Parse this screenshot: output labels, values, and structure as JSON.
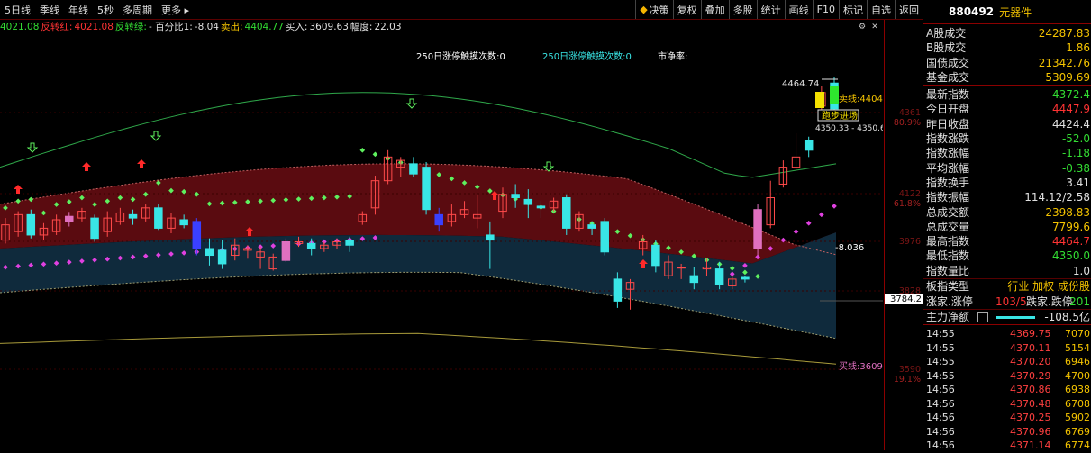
{
  "toolbar": {
    "left": [
      "5日线",
      "季线",
      "年线",
      "5秒",
      "多周期",
      "更多 ▸"
    ],
    "right": [
      "决策",
      "复权",
      "叠加",
      "多股",
      "统计",
      "画线",
      "F10",
      "标记",
      "自选",
      "返回"
    ]
  },
  "indicator_bar": [
    {
      "text": "4021.08",
      "color": "#33dd33"
    },
    {
      "text": "反转红:",
      "color": "#ff3333"
    },
    {
      "text": "4021.08",
      "color": "#ff3333"
    },
    {
      "text": "反转绿:",
      "color": "#33dd33"
    },
    {
      "text": "- 百分比1:",
      "color": "#e0e0e0"
    },
    {
      "text": "-8.04",
      "color": "#e0e0e0"
    },
    {
      "text": "卖出:",
      "color": "#f5c400"
    },
    {
      "text": "4404.77",
      "color": "#33dd33"
    },
    {
      "text": "买入:",
      "color": "#e0e0e0"
    },
    {
      "text": "3609.63",
      "color": "#e0e0e0"
    },
    {
      "text": "幅度:",
      "color": "#e0e0e0"
    },
    {
      "text": "22.03",
      "color": "#e0e0e0"
    }
  ],
  "chart_labels": {
    "touch1": "250日涨停触摸次数:0",
    "touch2": "250日涨停触摸次数:0",
    "pb": "市净率:",
    "high_mark": "4464.74",
    "sell_line": "卖线:4404",
    "run_enter": "跑步进场",
    "range_text": "4350.33 - 4350.6",
    "value_mark": "-8.036",
    "buy_line": "买线:3609"
  },
  "y_axis": [
    {
      "value": "4361",
      "pct": "80.9%"
    },
    {
      "value": "4122",
      "pct": "61.8%"
    },
    {
      "value": "3976",
      "pct": ""
    },
    {
      "value": "3828",
      "pct": ""
    },
    {
      "value": "3590",
      "pct": "19.1%"
    }
  ],
  "y_highlight": "3784.2",
  "panel": {
    "code": "880492",
    "name": "元器件",
    "rows1": [
      {
        "k": "A股成交",
        "v": "24287.83",
        "c": "#f5c400"
      },
      {
        "k": "B股成交",
        "v": "1.86",
        "c": "#f5c400"
      },
      {
        "k": "国债成交",
        "v": "21342.76",
        "c": "#f5c400"
      },
      {
        "k": "基金成交",
        "v": "5309.69",
        "c": "#f5c400"
      }
    ],
    "rows2": [
      {
        "k": "最新指数",
        "v": "4372.4",
        "c": "#33dd33"
      },
      {
        "k": "今日开盘",
        "v": "4447.9",
        "c": "#ff3333"
      },
      {
        "k": "昨日收盘",
        "v": "4424.4",
        "c": "#e0e0e0"
      },
      {
        "k": "指数涨跌",
        "v": "-52.0",
        "c": "#33dd33"
      },
      {
        "k": "指数涨幅",
        "v": "-1.18",
        "c": "#33dd33"
      },
      {
        "k": "平均涨幅",
        "v": "-0.38",
        "c": "#33dd33"
      },
      {
        "k": "指数换手",
        "v": "3.41",
        "c": "#e0e0e0"
      },
      {
        "k": "指数振幅",
        "v": "114.12/2.58",
        "c": "#e0e0e0"
      },
      {
        "k": "总成交额",
        "v": "2398.83",
        "c": "#f5c400"
      },
      {
        "k": "总成交量",
        "v": "7799.6",
        "c": "#f5c400"
      },
      {
        "k": "最高指数",
        "v": "4464.7",
        "c": "#ff3333"
      },
      {
        "k": "最低指数",
        "v": "4350.0",
        "c": "#33dd33"
      },
      {
        "k": "指数量比",
        "v": "1.0",
        "c": "#e0e0e0"
      }
    ],
    "board_type": {
      "k": "板指类型",
      "v": "行业 加权 成份股"
    },
    "updown": {
      "k1": "涨家.涨停",
      "v1": "103/5",
      "k2": "跌家.跌停",
      "v2": "201"
    },
    "net": {
      "k": "主力净额",
      "v": "-108.5亿"
    },
    "ticks": [
      {
        "t": "14:55",
        "p": "4369.75",
        "q": "7070"
      },
      {
        "t": "14:55",
        "p": "4370.11",
        "q": "5154"
      },
      {
        "t": "14:55",
        "p": "4370.20",
        "q": "6946"
      },
      {
        "t": "14:55",
        "p": "4370.29",
        "q": "4700"
      },
      {
        "t": "14:56",
        "p": "4370.86",
        "q": "6938"
      },
      {
        "t": "14:56",
        "p": "4370.48",
        "q": "6708"
      },
      {
        "t": "14:56",
        "p": "4370.25",
        "q": "5902"
      },
      {
        "t": "14:56",
        "p": "4370.96",
        "q": "6769"
      },
      {
        "t": "14:56",
        "p": "4371.14",
        "q": "6774"
      }
    ]
  },
  "chart_data": {
    "type": "candlestick",
    "candles": [
      {
        "o": 3985,
        "c": 4030,
        "h": 4050,
        "l": 3975
      },
      {
        "o": 4010,
        "c": 4060,
        "h": 4070,
        "l": 3995
      },
      {
        "o": 4060,
        "c": 4000,
        "h": 4075,
        "l": 3990
      },
      {
        "o": 4000,
        "c": 4020,
        "h": 4035,
        "l": 3985
      },
      {
        "o": 4010,
        "c": 4045,
        "h": 4060,
        "l": 4000
      },
      {
        "o": 4040,
        "c": 4055,
        "h": 4068,
        "l": 4025
      },
      {
        "o": 4050,
        "c": 4070,
        "h": 4080,
        "l": 4040
      },
      {
        "o": 4050,
        "c": 3990,
        "h": 4060,
        "l": 3980
      },
      {
        "o": 4010,
        "c": 4050,
        "h": 4070,
        "l": 3995
      },
      {
        "o": 4040,
        "c": 4065,
        "h": 4080,
        "l": 4030
      },
      {
        "o": 4060,
        "c": 4050,
        "h": 4075,
        "l": 4030
      },
      {
        "o": 4050,
        "c": 4080,
        "h": 4090,
        "l": 4040
      },
      {
        "o": 4080,
        "c": 4020,
        "h": 4090,
        "l": 4015
      },
      {
        "o": 4020,
        "c": 4050,
        "h": 4065,
        "l": 4005
      },
      {
        "o": 4045,
        "c": 4030,
        "h": 4060,
        "l": 4020
      },
      {
        "o": 4040,
        "c": 3960,
        "h": 4050,
        "l": 3940
      },
      {
        "o": 3960,
        "c": 3940,
        "h": 3990,
        "l": 3910
      },
      {
        "o": 3955,
        "c": 3915,
        "h": 3985,
        "l": 3900
      },
      {
        "o": 3940,
        "c": 3970,
        "h": 3990,
        "l": 3925
      },
      {
        "o": 3955,
        "c": 3960,
        "h": 3970,
        "l": 3930
      },
      {
        "o": 3935,
        "c": 3950,
        "h": 3965,
        "l": 3900
      },
      {
        "o": 3900,
        "c": 3935,
        "h": 3945,
        "l": 3895
      },
      {
        "o": 3925,
        "c": 3980,
        "h": 3990,
        "l": 3920
      },
      {
        "o": 3975,
        "c": 3980,
        "h": 3995,
        "l": 3965
      },
      {
        "o": 3975,
        "c": 3960,
        "h": 3990,
        "l": 3940
      },
      {
        "o": 3960,
        "c": 3970,
        "h": 3980,
        "l": 3950
      },
      {
        "o": 3970,
        "c": 3980,
        "h": 3990,
        "l": 3960
      },
      {
        "o": 3985,
        "c": 3970,
        "h": 3995,
        "l": 3950
      },
      {
        "o": 4040,
        "c": 4060,
        "h": 4070,
        "l": 4030
      },
      {
        "o": 4080,
        "c": 4160,
        "h": 4175,
        "l": 4060
      },
      {
        "o": 4160,
        "c": 4230,
        "h": 4250,
        "l": 4150
      },
      {
        "o": 4200,
        "c": 4220,
        "h": 4230,
        "l": 4170
      },
      {
        "o": 4210,
        "c": 4180,
        "h": 4230,
        "l": 4170
      },
      {
        "o": 4200,
        "c": 4075,
        "h": 4215,
        "l": 4060
      },
      {
        "o": 4060,
        "c": 4030,
        "h": 4080,
        "l": 4010
      },
      {
        "o": 4040,
        "c": 4060,
        "h": 4090,
        "l": 4025
      },
      {
        "o": 4060,
        "c": 4075,
        "h": 4100,
        "l": 4050
      },
      {
        "o": 4050,
        "c": 4060,
        "h": 4120,
        "l": 4020
      },
      {
        "o": 4000,
        "c": 3985,
        "h": 4040,
        "l": 3900
      },
      {
        "o": 4070,
        "c": 4120,
        "h": 4140,
        "l": 4050
      },
      {
        "o": 4120,
        "c": 4110,
        "h": 4150,
        "l": 4080
      },
      {
        "o": 4105,
        "c": 4090,
        "h": 4135,
        "l": 4050
      },
      {
        "o": 4085,
        "c": 4080,
        "h": 4100,
        "l": 4050
      },
      {
        "o": 4080,
        "c": 4100,
        "h": 4110,
        "l": 4070
      },
      {
        "o": 4110,
        "c": 4020,
        "h": 4120,
        "l": 4000
      },
      {
        "o": 4020,
        "c": 4060,
        "h": 4070,
        "l": 4010
      },
      {
        "o": 4030,
        "c": 4020,
        "h": 4040,
        "l": 4000
      },
      {
        "o": 4040,
        "c": 3950,
        "h": 4050,
        "l": 3940
      },
      {
        "o": 3870,
        "c": 3805,
        "h": 3890,
        "l": 3785
      },
      {
        "o": 3840,
        "c": 3860,
        "h": 3870,
        "l": 3780
      },
      {
        "o": 3960,
        "c": 3980,
        "h": 4000,
        "l": 3940
      },
      {
        "o": 3970,
        "c": 3910,
        "h": 3985,
        "l": 3890
      },
      {
        "o": 3880,
        "c": 3920,
        "h": 3940,
        "l": 3870
      },
      {
        "o": 3905,
        "c": 3905,
        "h": 3915,
        "l": 3870
      },
      {
        "o": 3880,
        "c": 3860,
        "h": 3905,
        "l": 3840
      },
      {
        "o": 3900,
        "c": 3905,
        "h": 3930,
        "l": 3880
      },
      {
        "o": 3900,
        "c": 3855,
        "h": 3920,
        "l": 3840
      },
      {
        "o": 3850,
        "c": 3870,
        "h": 3880,
        "l": 3840
      },
      {
        "o": 3875,
        "c": 3870,
        "h": 3880,
        "l": 3860
      },
      {
        "o": 3960,
        "c": 4075,
        "h": 4090,
        "l": 3940
      },
      {
        "o": 4030,
        "c": 4110,
        "h": 4160,
        "l": 4020
      },
      {
        "o": 4150,
        "c": 4200,
        "h": 4220,
        "l": 4140
      },
      {
        "o": 4200,
        "c": 4230,
        "h": 4300,
        "l": 4190
      },
      {
        "o": 4280,
        "c": 4250,
        "h": 4290,
        "l": 4230
      },
      {
        "o": 4380,
        "c": 4420,
        "h": 4440,
        "l": 4370
      },
      {
        "o": 4448,
        "c": 4372,
        "h": 4465,
        "l": 4350
      }
    ]
  }
}
